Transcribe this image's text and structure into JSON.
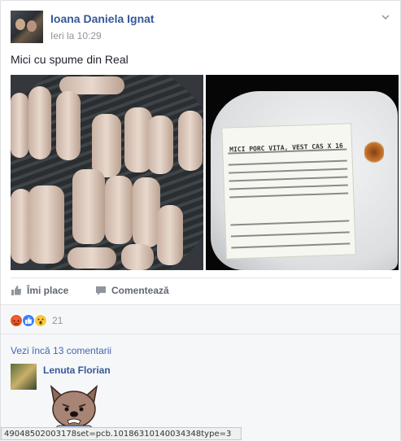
{
  "post": {
    "author": "Ioana Daniela Ignat",
    "time": "Ieri la 10:29",
    "text": "Mici cu spume din Real",
    "icons": {
      "privacy": "globe-icon",
      "menu": "chevron-down-icon"
    }
  },
  "photos": {
    "right_label_title": "MICI PORC VITA, VEST CAS X 16"
  },
  "actions": {
    "like_label": "Îmi place",
    "comment_label": "Comentează"
  },
  "reactions": {
    "types": [
      "angry",
      "like",
      "wow"
    ],
    "count": "21",
    "colors": {
      "angry": "#e9410f",
      "like": "#4080ff",
      "wow": "#f7c93a"
    }
  },
  "comments": {
    "more_label": "Vezi încă 13 comentarii",
    "items": [
      {
        "author": "Lenuta Florian",
        "sticker": "french-bulldog-sticker"
      }
    ]
  },
  "status_bar": {
    "url": "49048502003178set=pcb.10186310140034348type=3"
  },
  "colors": {
    "link": "#365899",
    "muted": "#90949c",
    "action": "#616770"
  }
}
